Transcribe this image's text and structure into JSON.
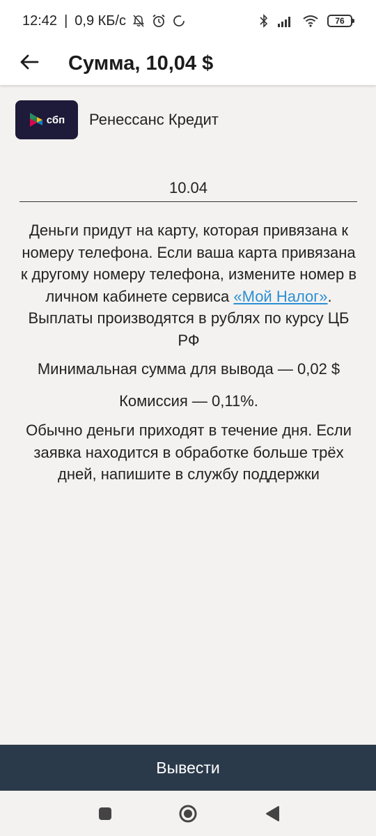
{
  "status_bar": {
    "time": "12:42",
    "separator": "|",
    "speed": "0,9 КБ/с",
    "battery": "76",
    "icons": [
      "mute-icon",
      "alarm-icon",
      "sync-icon",
      "bluetooth-icon",
      "signal-icon",
      "wifi-icon",
      "battery-icon"
    ]
  },
  "header": {
    "title": "Сумма, 10,04 $",
    "back_icon": "arrow-left-icon"
  },
  "bank": {
    "logo_text": "сбп",
    "name": "Ренессанс Кредит"
  },
  "amount": {
    "value": "10.04"
  },
  "info": {
    "main_before_link": "Деньги придут на карту, которая привязана к номеру телефона. Если ваша карта привязана к другому номеру телефона, измените номер в личном кабинете сервиса ",
    "link_text": "«Мой Налог»",
    "main_after_link": ". Выплаты производятся в рублях по курсу ЦБ РФ",
    "min_amount": "Минимальная сумма для вывода — 0,02 $",
    "fee": "Комиссия — 0,11%.",
    "timing": "Обычно деньги приходят в течение дня. Если заявка находится в обработке больше трёх дней, напишите в службу поддержки"
  },
  "actions": {
    "withdraw_label": "Вывести"
  },
  "colors": {
    "background": "#f4f2f0",
    "button": "#2b3a4a",
    "link": "#2a8fd4",
    "logo_bg": "#1e1a3a"
  }
}
